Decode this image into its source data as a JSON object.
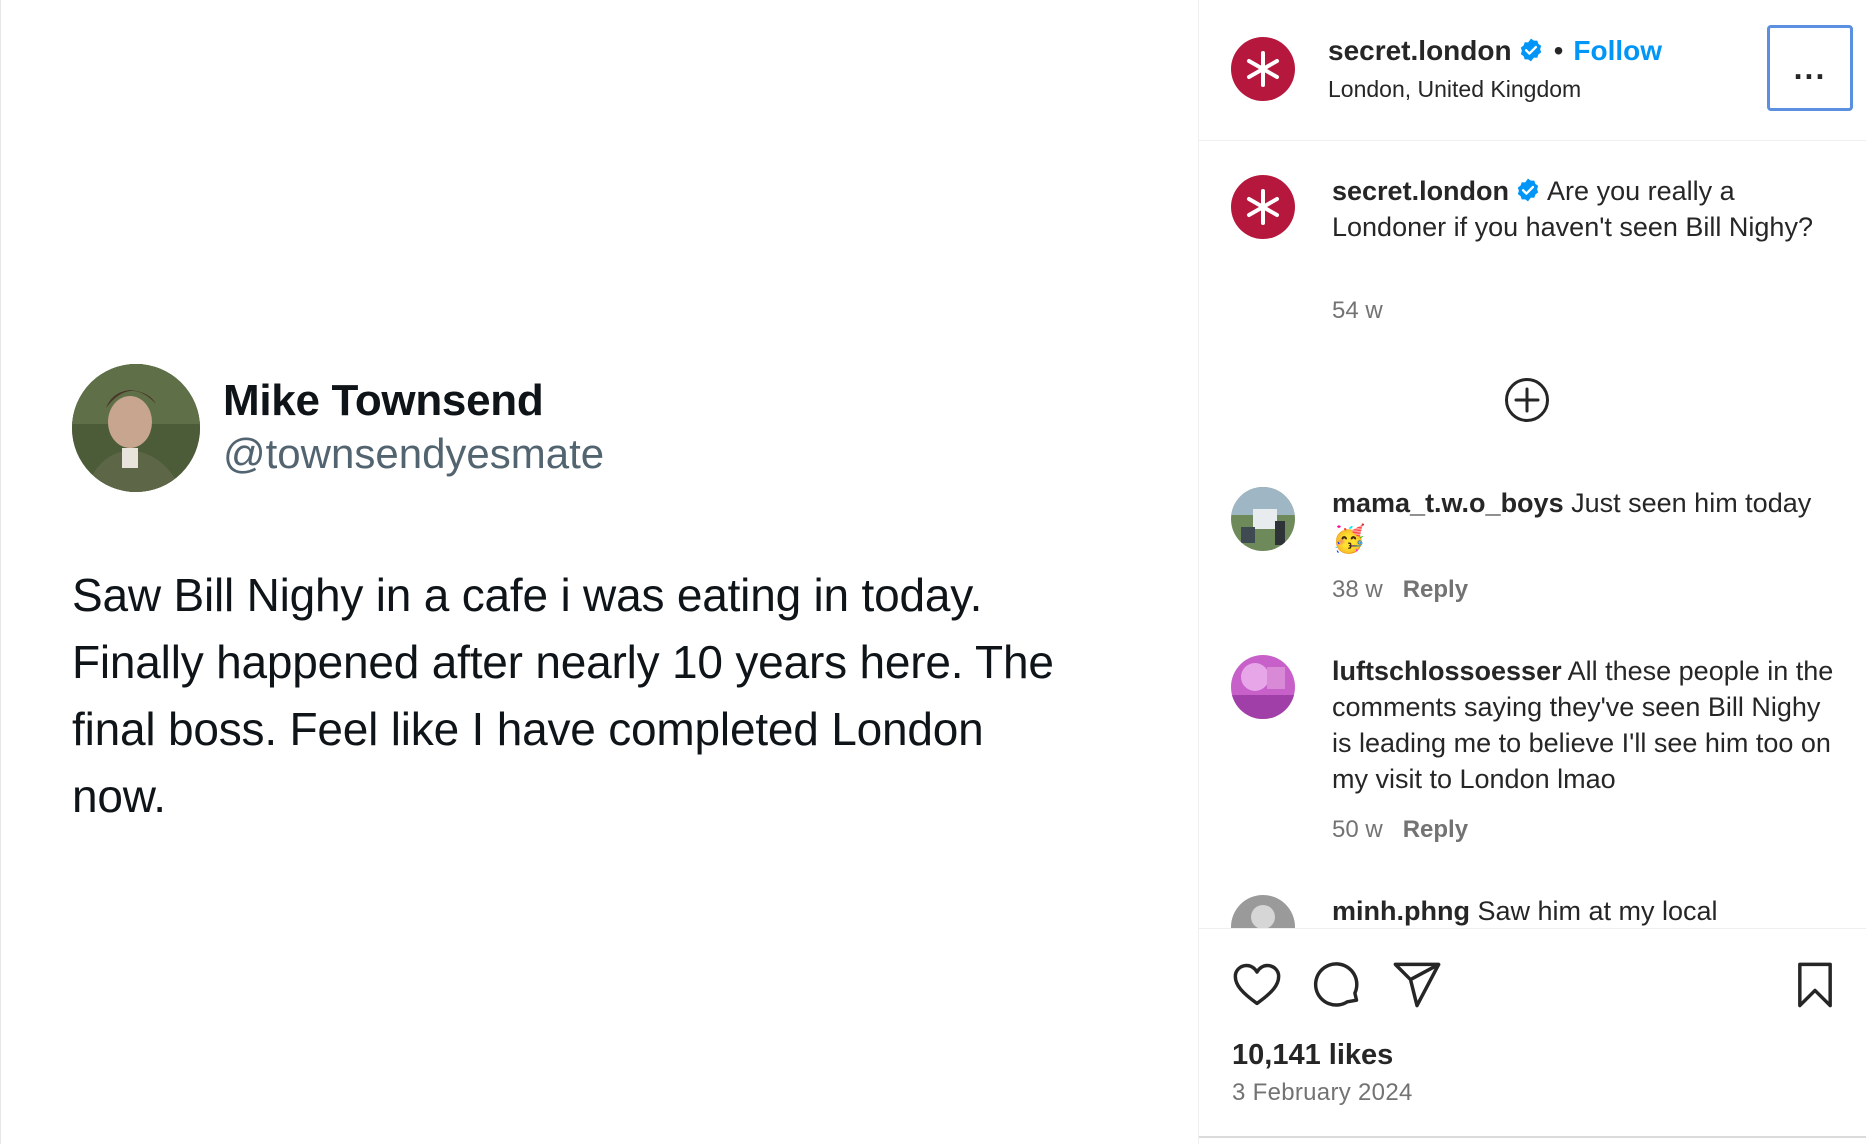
{
  "post_media": {
    "tweet": {
      "name": "Mike Townsend",
      "handle": "@townsendyesmate",
      "text_lines": [
        "Saw Bill Nighy in a cafe i was eating in today.",
        "Finally happened after nearly 10 years here. The",
        "final boss. Feel like I have completed London",
        "now."
      ]
    }
  },
  "header": {
    "username": "secret.london",
    "separator": "•",
    "follow_label": "Follow",
    "location": "London, United Kingdom",
    "more_label": "...",
    "verified_icon": "verified-badge-icon",
    "colors": {
      "brand": "#b5173d",
      "accent": "#0095f6",
      "verified": "#0095f6"
    }
  },
  "caption": {
    "username": "secret.london",
    "text": "Are you really a Londoner if you haven't seen Bill Nighy?",
    "time": "54 w"
  },
  "load_more_icon": "plus-circle-icon",
  "comments": [
    {
      "username": "mama_t.w.o_boys",
      "text": "Just seen him today 🥳",
      "time": "38 w",
      "reply_label": "Reply"
    },
    {
      "username": "luftschlossoesser",
      "text": "All these people in the comments saying they've seen Bill Nighy is leading me to believe I'll see him too on my visit to London lmao",
      "time": "50 w",
      "reply_label": "Reply"
    },
    {
      "username": "minh.phng",
      "text": "Saw him at my local"
    }
  ],
  "actions": {
    "icons": [
      "heart-icon",
      "comment-icon",
      "share-icon",
      "bookmark-icon"
    ],
    "likes": "10,141 likes",
    "date": "3 February 2024"
  }
}
